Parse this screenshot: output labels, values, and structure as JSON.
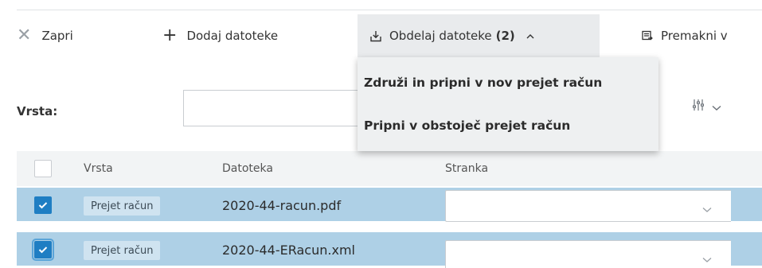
{
  "toolbar": {
    "close_label": "Zapri",
    "add_label": "Dodaj datoteke",
    "process_label": "Obdelaj datoteke",
    "process_count": "(2)",
    "move_label": "Premakni v"
  },
  "menu": {
    "items": [
      {
        "label": "Združi in pripni v nov prejet račun"
      },
      {
        "label": "Pripni v obstoječ prejet račun"
      }
    ]
  },
  "filter": {
    "label": "Vrsta:",
    "value": ""
  },
  "table": {
    "columns": [
      "Vrsta",
      "Datoteka",
      "Stranka"
    ],
    "rows": [
      {
        "checked": true,
        "type": "Prejet račun",
        "file": "2020-44-racun.pdf",
        "party": ""
      },
      {
        "checked": true,
        "type": "Prejet račun",
        "file": "2020-44-ERacun.xml",
        "party": ""
      }
    ]
  },
  "colors": {
    "selected_row": "#aed0e6",
    "checkbox_checked": "#1f7ec3",
    "active_button_bg": "#e9ebed",
    "menu_bg": "#eef0f1",
    "header_bg": "#f2f4f5"
  },
  "icons": {
    "close": "close-icon",
    "add": "plus-icon",
    "process": "download-tray-icon",
    "move": "document-move-icon",
    "settings": "sliders-icon",
    "dropdown": "chevron-down-icon"
  }
}
